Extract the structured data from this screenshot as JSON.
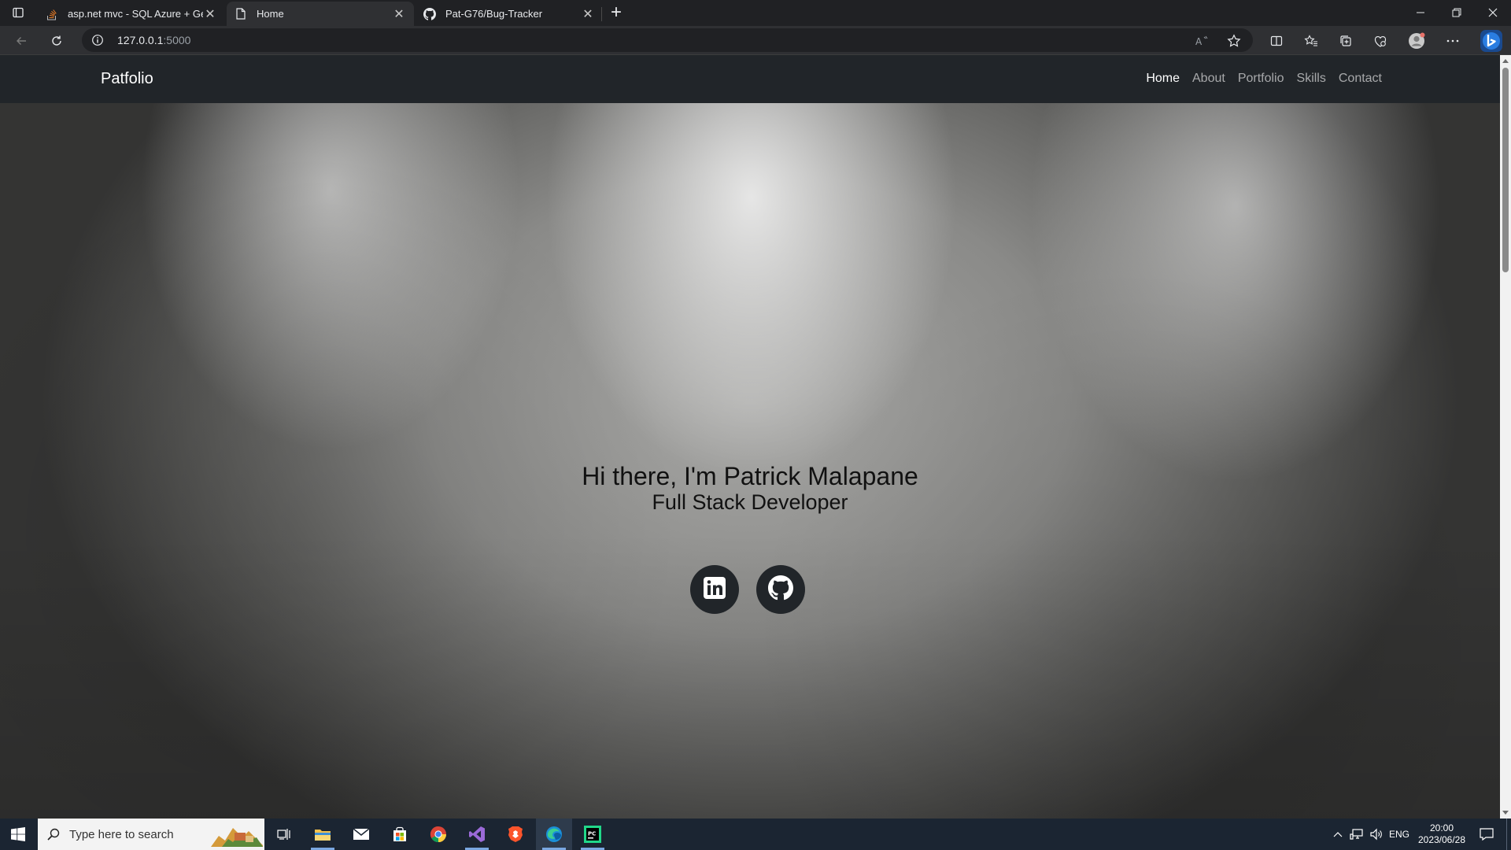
{
  "browser": {
    "tabs": [
      {
        "title": "asp.net mvc - SQL Azure + Getti",
        "favicon": "stackoverflow-icon",
        "active": false
      },
      {
        "title": "Home",
        "favicon": "page-icon",
        "active": true
      },
      {
        "title": "Pat-G76/Bug-Tracker",
        "favicon": "github-icon",
        "active": false
      }
    ],
    "url_host": "127.0.0.1",
    "url_port": ":5000"
  },
  "page": {
    "brand": "Patfolio",
    "nav": [
      {
        "label": "Home",
        "active": true
      },
      {
        "label": "About",
        "active": false
      },
      {
        "label": "Portfolio",
        "active": false
      },
      {
        "label": "Skills",
        "active": false
      },
      {
        "label": "Contact",
        "active": false
      }
    ],
    "hero": {
      "title": "Hi there, I'm Patrick Malapane",
      "subtitle": "Full Stack Developer",
      "socials": [
        {
          "name": "linkedin-icon"
        },
        {
          "name": "github-icon"
        }
      ]
    }
  },
  "taskbar": {
    "search_placeholder": "Type here to search",
    "language": "ENG",
    "time": "20:00",
    "date": "2023/06/28"
  },
  "colors": {
    "navbar_bg": "#212529",
    "taskbar_bg": "#1b2532",
    "browser_bg": "#202124"
  }
}
